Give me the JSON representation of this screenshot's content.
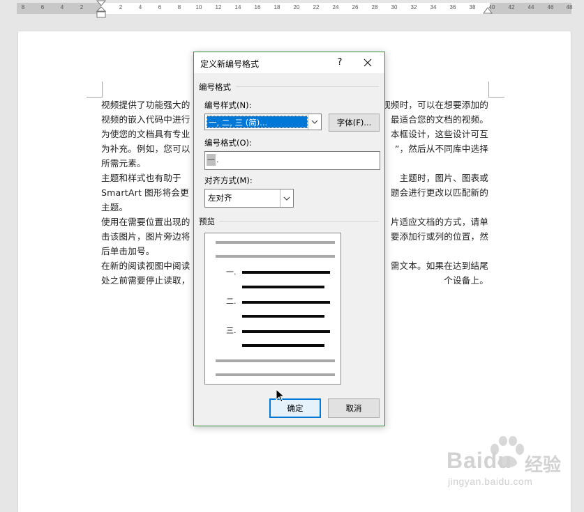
{
  "ruler": {
    "labels": [
      "8",
      "6",
      "4",
      "2",
      "2",
      "4",
      "6",
      "8",
      "10",
      "12",
      "14",
      "16",
      "18",
      "20",
      "22",
      "24",
      "26",
      "28",
      "30",
      "32",
      "34",
      "36",
      "38",
      "40",
      "42",
      "44",
      "46",
      "48"
    ]
  },
  "document": {
    "paragraph_lines": [
      [
        "视频提供了功能强大的",
        "视频时，可以在想要添加的"
      ],
      [
        "视频的嵌入代码中进行",
        "最适合您的文档的视频。"
      ],
      [
        "为使您的文档具有专业",
        "本框设计，这些设计可互"
      ],
      [
        "为补充。例如，您可以",
        "”，然后从不同库中选择"
      ],
      [
        "所需元素。",
        ""
      ],
      [
        "主题和样式也有助于",
        "主题时，图片、图表或"
      ],
      [
        "SmartArt 图形将会更",
        "题会进行更改以匹配新的"
      ],
      [
        "主题。",
        ""
      ],
      [
        "使用在需要位置出现的",
        "片适应文档的方式，请单"
      ],
      [
        "击该图片，图片旁边将",
        "要添加行或列的位置，然"
      ],
      [
        "后单击加号。",
        ""
      ],
      [
        "在新的阅读视图中阅读",
        "需文本。如果在达到结尾"
      ],
      [
        "处之前需要停止读取，",
        "个设备上。"
      ]
    ]
  },
  "dialog": {
    "title": "定义新编号格式",
    "help": "?",
    "close": "✕",
    "group_label": "编号格式",
    "style_label": "编号样式(N):",
    "style_value": "一, 二, 三 (简)...",
    "font_button": "字体(F)...",
    "format_label": "编号格式(O):",
    "format_value_highlight": "一",
    "format_value_rest": ".",
    "align_label": "对齐方式(M):",
    "align_value": "左对齐",
    "preview_label": "预览",
    "preview_numbers": [
      "一.",
      "二.",
      "三."
    ],
    "ok_button": "确定",
    "cancel_button": "取消"
  },
  "watermark": {
    "brand": "Baidu",
    "brand_cn": "经验",
    "url": "jingyan.baidu.com"
  }
}
